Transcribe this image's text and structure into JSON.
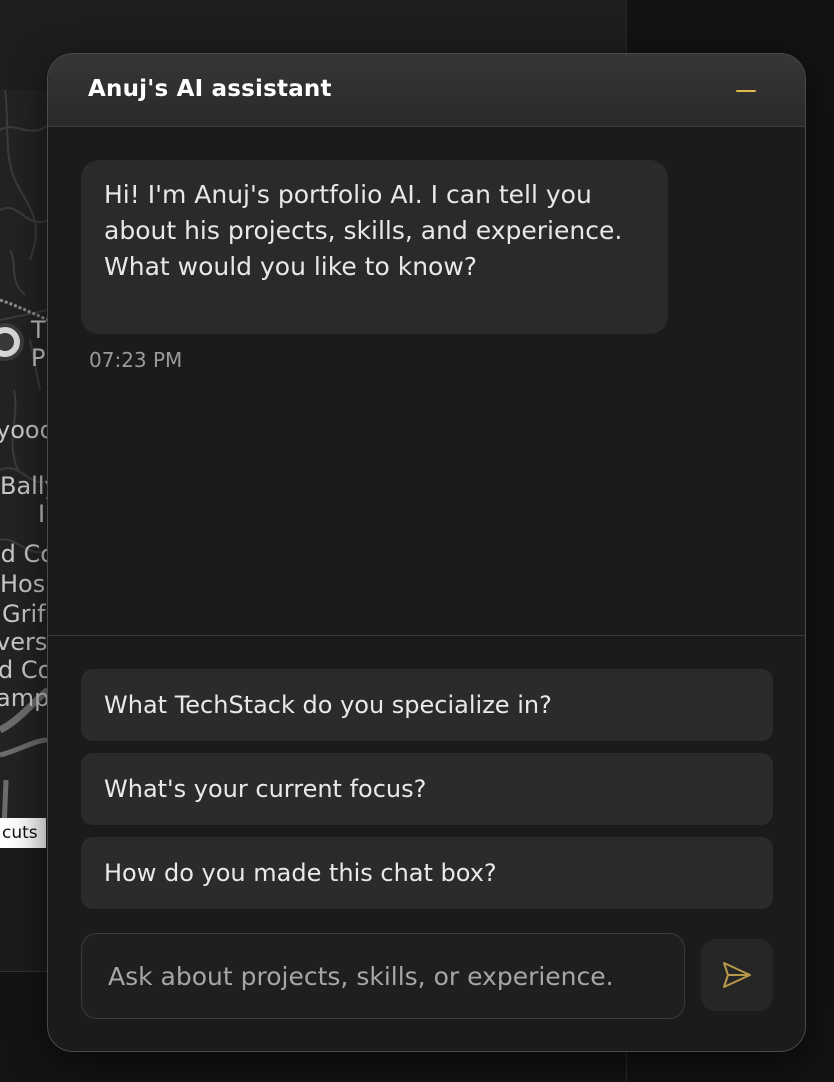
{
  "background": {
    "map_labels": [
      "T",
      "P",
      "yood",
      "Bally",
      "I",
      "ld Co",
      "Hos",
      "Grif",
      "vers",
      "d Co",
      "amp"
    ],
    "map_shortcuts_label": "cuts"
  },
  "chat": {
    "title": "Anuj's AI assistant",
    "minimize_icon": "minus-icon",
    "accent_color": "#e2b84a",
    "messages": [
      {
        "role": "assistant",
        "text": "Hi! I'm Anuj's portfolio AI. I can tell you about his projects, skills, and experience. What would you like to know?",
        "time": "07:23 PM"
      }
    ],
    "suggestions": [
      "What TechStack do you specialize in?",
      "What's your current focus?",
      "How do you made this chat box?"
    ],
    "input": {
      "value": "",
      "placeholder": "Ask about projects, skills, or experience."
    },
    "send_icon": "send-icon"
  }
}
